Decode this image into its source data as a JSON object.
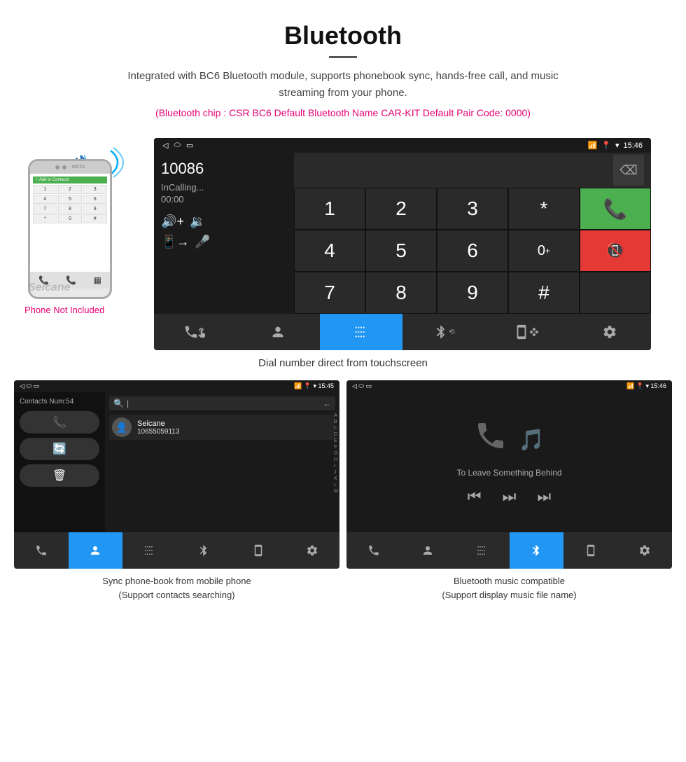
{
  "header": {
    "title": "Bluetooth",
    "description": "Integrated with BC6 Bluetooth module, supports phonebook sync, hands-free call, and music streaming from your phone.",
    "bluetooth_info": "(Bluetooth chip : CSR BC6    Default Bluetooth Name CAR-KIT    Default Pair Code: 0000)"
  },
  "phone_mockup": {
    "not_included": "Phone Not Included",
    "watermark": "Seicane"
  },
  "dial_screen": {
    "status_time": "15:46",
    "dial_number": "10086",
    "in_calling": "InCalling...",
    "timer": "00:00",
    "numpad": [
      "1",
      "2",
      "3",
      "*",
      "4",
      "5",
      "6",
      "0+",
      "7",
      "8",
      "9",
      "#"
    ],
    "caption": "Dial number direct from touchscreen"
  },
  "contacts_screen": {
    "status_time": "15:45",
    "contacts_num": "Contacts Num:54",
    "contact_name": "Seicane",
    "contact_number": "10655059113",
    "caption_line1": "Sync phone-book from mobile phone",
    "caption_line2": "(Support contacts searching)"
  },
  "music_screen": {
    "status_time": "15:46",
    "song_title": "To Leave Something Behind",
    "caption_line1": "Bluetooth music compatible",
    "caption_line2": "(Support display music file name)"
  },
  "nav_items": {
    "phone": "📞",
    "contacts": "👤",
    "keypad": "⌨",
    "bluetooth": "⚡",
    "transfer": "📋",
    "settings": "⚙"
  },
  "alpha_list": [
    "A",
    "B",
    "C",
    "D",
    "E",
    "F",
    "G",
    "H",
    "I",
    "J",
    "K",
    "L",
    "M"
  ]
}
